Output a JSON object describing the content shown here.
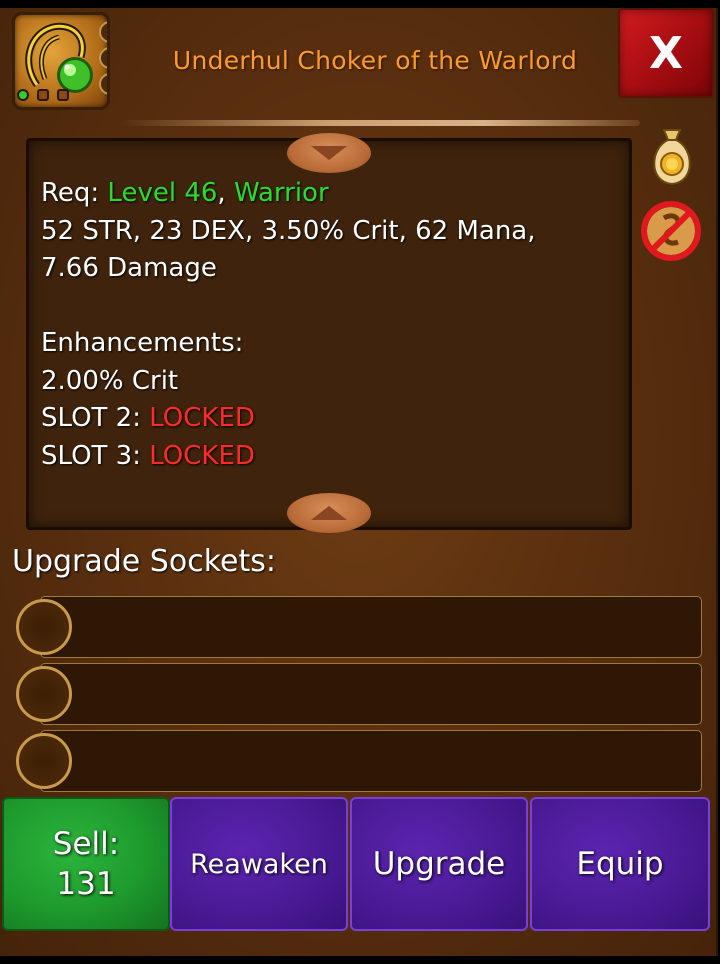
{
  "header": {
    "item_name": "Underhul Choker of the Warlord",
    "close_label": "X"
  },
  "stats": {
    "req_prefix": "Req: ",
    "req_level": "Level 46",
    "req_sep": ", ",
    "req_class": "Warrior",
    "line1": "52 STR, 23 DEX, 3.50% Crit, 62 Mana,",
    "line2": "7.66 Damage",
    "enh_title": "Enhancements:",
    "enh_1": "2.00% Crit",
    "slot2_prefix": "SLOT 2: ",
    "slot2_status": "LOCKED",
    "slot3_prefix": "SLOT 3: ",
    "slot3_status": "LOCKED"
  },
  "sockets": {
    "label": "Upgrade Sockets:",
    "count": 3
  },
  "buttons": {
    "sell_label": "Sell:",
    "sell_value": "131",
    "reawaken": "Reawaken",
    "upgrade": "Upgrade",
    "equip": "Equip"
  },
  "colors": {
    "title": "#ff9a2e",
    "requirement_met": "#2cdc2c",
    "locked": "#ff2a2a",
    "sell_button": "#1e9a2d",
    "action_button": "#4a1b96",
    "close_button": "#a80e12"
  },
  "icons": {
    "item": "choker-item-icon",
    "bag": "gold-bag-icon",
    "no_sell": "no-sell-icon",
    "scroll_up": "scroll-up-arrow-icon",
    "scroll_down": "scroll-down-arrow-icon"
  }
}
